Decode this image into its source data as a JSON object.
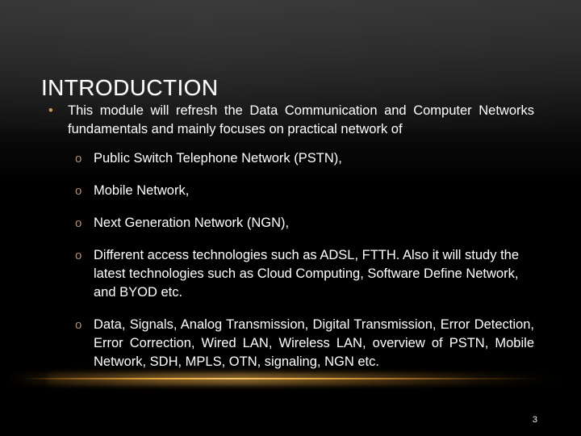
{
  "slide": {
    "title": "INTRODUCTION",
    "page_number": "3",
    "accent_bullet_color": "#c89b5e",
    "accent_subbullet_color": "#b58d72",
    "glow_color": "#f5c468",
    "background_top_color": "#353535",
    "background_bottom_color": "#000000",
    "text_color": "#ffffff"
  },
  "body": {
    "bullets": [
      {
        "marker": "•",
        "text": "This module will refresh the Data Communication and Computer Networks fundamentals and mainly focuses on practical network of"
      }
    ],
    "sub_bullets": [
      {
        "marker": "o",
        "text": "Public Switch Telephone Network (PSTN),"
      },
      {
        "marker": "o",
        "text": "Mobile Network,"
      },
      {
        "marker": "o",
        "text": "Next Generation Network (NGN),"
      },
      {
        "marker": "o",
        "text": "Different access technologies such as ADSL, FTTH. Also it will study the latest technologies such as Cloud Computing, Software Define Network, and BYOD etc."
      },
      {
        "marker": "o",
        "text": "Data, Signals, Analog Transmission, Digital Transmission, Error Detection, Error Correction, Wired LAN, Wireless LAN, overview of PSTN, Mobile Network, SDH, MPLS, OTN, signaling, NGN etc."
      }
    ]
  }
}
